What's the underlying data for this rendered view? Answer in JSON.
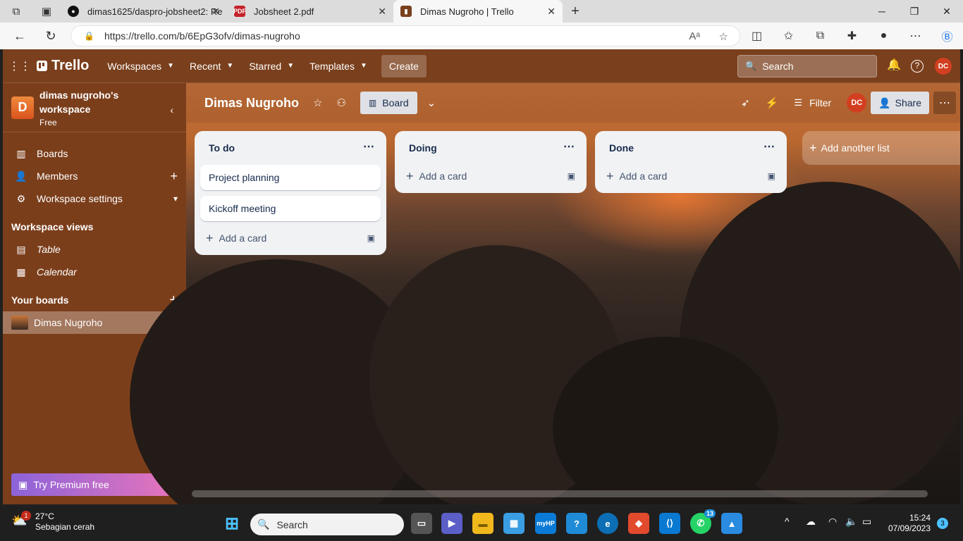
{
  "browser": {
    "tabs": [
      {
        "title": "dimas1625/daspro-jobsheet2: Re",
        "icon": "github-icon"
      },
      {
        "title": "Jobsheet 2.pdf",
        "icon": "pdf-icon"
      },
      {
        "title": "Dimas Nugroho | Trello",
        "icon": "trello-icon"
      }
    ],
    "url": "https://trello.com/b/6EpG3ofv/dimas-nugroho"
  },
  "header": {
    "logo": "Trello",
    "menus": [
      "Workspaces",
      "Recent",
      "Starred",
      "Templates"
    ],
    "create_label": "Create",
    "search_placeholder": "Search",
    "avatar_initials": "DC"
  },
  "sidebar": {
    "workspace_initial": "D",
    "workspace_name": "dimas nugroho's workspace",
    "workspace_plan": "Free",
    "items": [
      {
        "label": "Boards",
        "icon": "boards-icon"
      },
      {
        "label": "Members",
        "icon": "person-icon"
      },
      {
        "label": "Workspace settings",
        "icon": "gear-icon"
      }
    ],
    "views_heading": "Workspace views",
    "views": [
      {
        "label": "Table",
        "icon": "table-icon"
      },
      {
        "label": "Calendar",
        "icon": "calendar-icon"
      }
    ],
    "boards_heading": "Your boards",
    "boards": [
      {
        "label": "Dimas Nugroho"
      }
    ],
    "premium_label": "Try Premium free"
  },
  "board": {
    "title": "Dimas Nugroho",
    "view_label": "Board",
    "filter_label": "Filter",
    "share_label": "Share",
    "member_initials": "DC",
    "lists": [
      {
        "title": "To do",
        "cards": [
          "Project planning",
          "Kickoff meeting"
        ],
        "add_label": "Add a card"
      },
      {
        "title": "Doing",
        "cards": [],
        "add_label": "Add a card"
      },
      {
        "title": "Done",
        "cards": [],
        "add_label": "Add a card"
      }
    ],
    "add_list_label": "Add another list"
  },
  "taskbar": {
    "temperature": "27°C",
    "weather": "Sebagian cerah",
    "weather_badge": "1",
    "search_placeholder": "Search",
    "whatsapp_badge": "13",
    "time": "15:24",
    "date": "07/09/2023",
    "notification_count": "3"
  },
  "colors": {
    "header_bg": "#7a3f1c",
    "sidebar_bg": "#7b3e1b",
    "list_bg": "#f1f2f4",
    "avatar_bg": "#d23f20"
  }
}
